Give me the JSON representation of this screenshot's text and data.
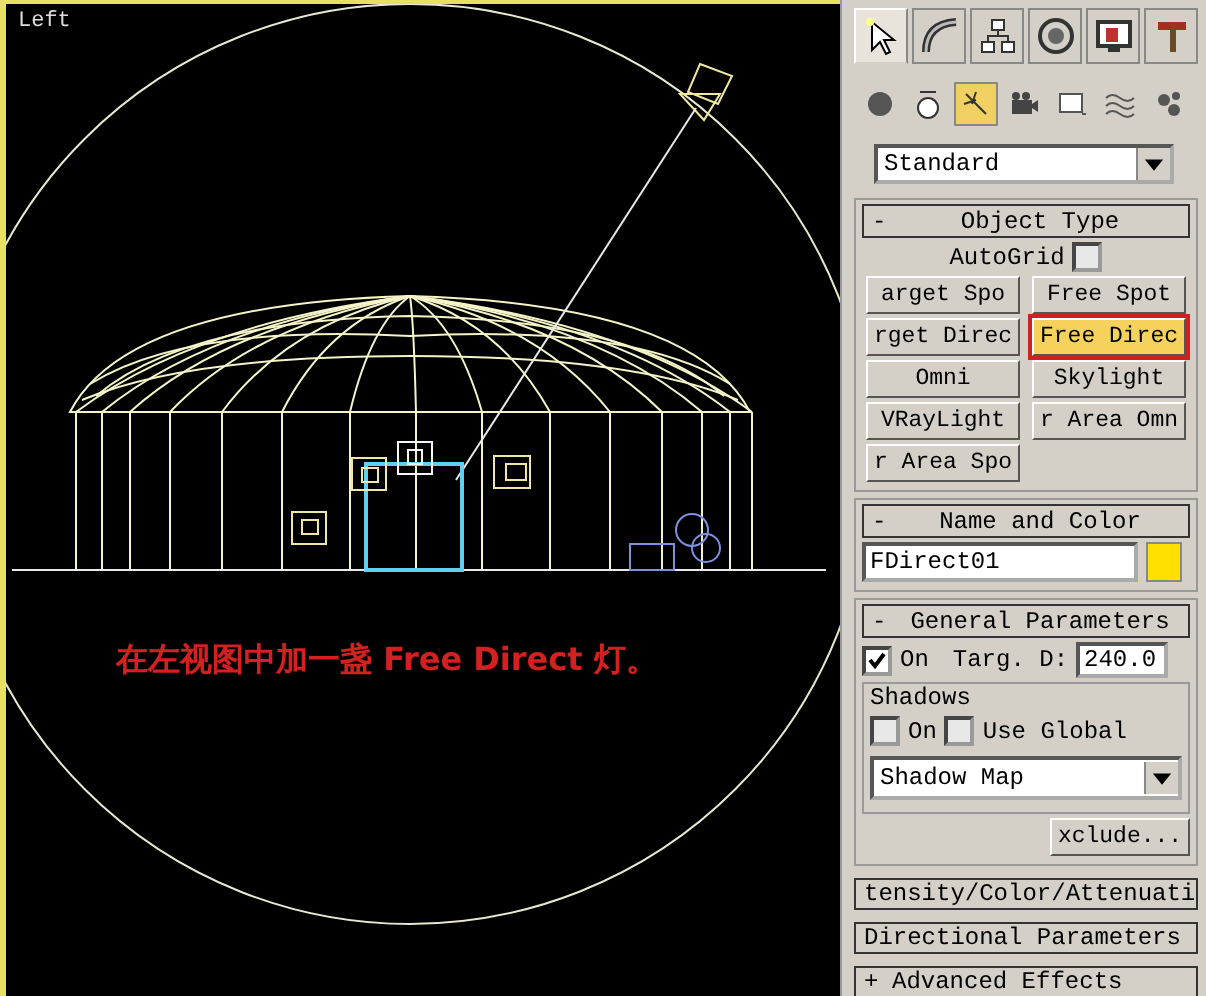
{
  "viewport": {
    "label": "Left",
    "caption": "在左视图中加一盏 Free Direct 灯。"
  },
  "command_tabs": [
    {
      "kind": "create",
      "selected": true
    },
    {
      "kind": "modify",
      "selected": false
    },
    {
      "kind": "hierarchy",
      "selected": false
    },
    {
      "kind": "motion",
      "selected": false
    },
    {
      "kind": "display",
      "selected": false
    },
    {
      "kind": "utilities",
      "selected": false
    }
  ],
  "categories": [
    {
      "kind": "geometry",
      "selected": false
    },
    {
      "kind": "shapes",
      "selected": false
    },
    {
      "kind": "lights",
      "selected": true
    },
    {
      "kind": "cameras",
      "selected": false
    },
    {
      "kind": "helpers",
      "selected": false
    },
    {
      "kind": "spacewarps",
      "selected": false
    },
    {
      "kind": "systems",
      "selected": false
    }
  ],
  "type_dropdown": {
    "value": "Standard"
  },
  "object_type": {
    "title": "Object Type",
    "toggle": "-",
    "autogrid": {
      "label": "AutoGrid",
      "checked": false
    },
    "buttons": [
      {
        "label": "arget Spo",
        "selected": false
      },
      {
        "label": "Free Spot",
        "selected": false
      },
      {
        "label": "rget Direc",
        "selected": false
      },
      {
        "label": "Free Direc",
        "selected": true
      },
      {
        "label": "Omni",
        "selected": false
      },
      {
        "label": "Skylight",
        "selected": false
      },
      {
        "label": "VRayLight",
        "selected": false
      },
      {
        "label": "r Area Omn",
        "selected": false
      },
      {
        "label": "r Area Spo",
        "selected": false
      }
    ]
  },
  "name_and_color": {
    "title": "Name and Color",
    "toggle": "-",
    "name": "FDirect01",
    "color": "#ffe000"
  },
  "general_parameters": {
    "title": "General Parameters",
    "toggle": "-",
    "on": {
      "label": "On",
      "checked": true
    },
    "target_label": "Targ. D:",
    "target_distance": "240.0",
    "shadows": {
      "title": "Shadows",
      "on": {
        "label": "On",
        "checked": false
      },
      "use_global": {
        "label": "Use Global",
        "checked": false
      },
      "type": "Shadow Map",
      "exclude": "xclude..."
    }
  },
  "collapsed_rollouts": [
    {
      "title": "tensity/Color/Attenuati"
    },
    {
      "title": "Directional Parameters"
    },
    {
      "title": "Advanced Effects",
      "toggle": "+"
    }
  ]
}
